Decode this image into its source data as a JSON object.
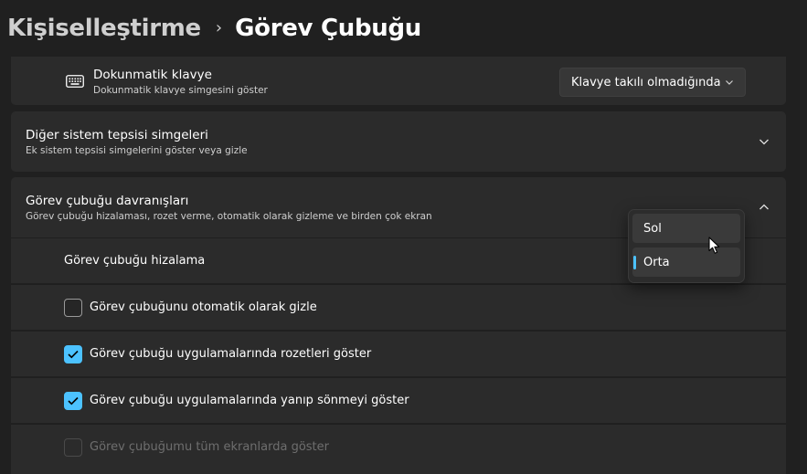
{
  "breadcrumb": {
    "parent": "Kişiselleştirme",
    "separator": "›",
    "current": "Görev Çubuğu"
  },
  "touch_keyboard": {
    "icon": "keyboard-icon",
    "title": "Dokunmatik klavye",
    "subtitle": "Dokunmatik klavye simgesini göster",
    "dropdown_value": "Klavye takılı olmadığında"
  },
  "other_tray": {
    "title": "Diğer sistem tepsisi simgeleri",
    "subtitle": "Ek sistem tepsisi simgelerini göster veya gizle"
  },
  "behaviors": {
    "title": "Görev çubuğu davranışları",
    "subtitle": "Görev çubuğu hizalaması, rozet verme, otomatik olarak gizleme ve birden çok ekran",
    "alignment_label": "Görev çubuğu hizalama",
    "alignment_options": [
      "Sol",
      "Orta"
    ],
    "alignment_selected": "Orta",
    "autohide_label": "Görev çubuğunu otomatik olarak gizle",
    "autohide_checked": false,
    "badges_label": "Görev çubuğu uygulamalarında rozetleri göster",
    "badges_checked": true,
    "flashing_label": "Görev çubuğu uygulamalarında yanıp sönmeyi göster",
    "flashing_checked": true,
    "all_displays_label": "Görev çubuğumu tüm ekranlarda göster",
    "all_displays_checked": false,
    "all_displays_disabled": true
  },
  "colors": {
    "accent": "#4cc2ff",
    "background": "#202020",
    "card": "#2b2b2b"
  }
}
